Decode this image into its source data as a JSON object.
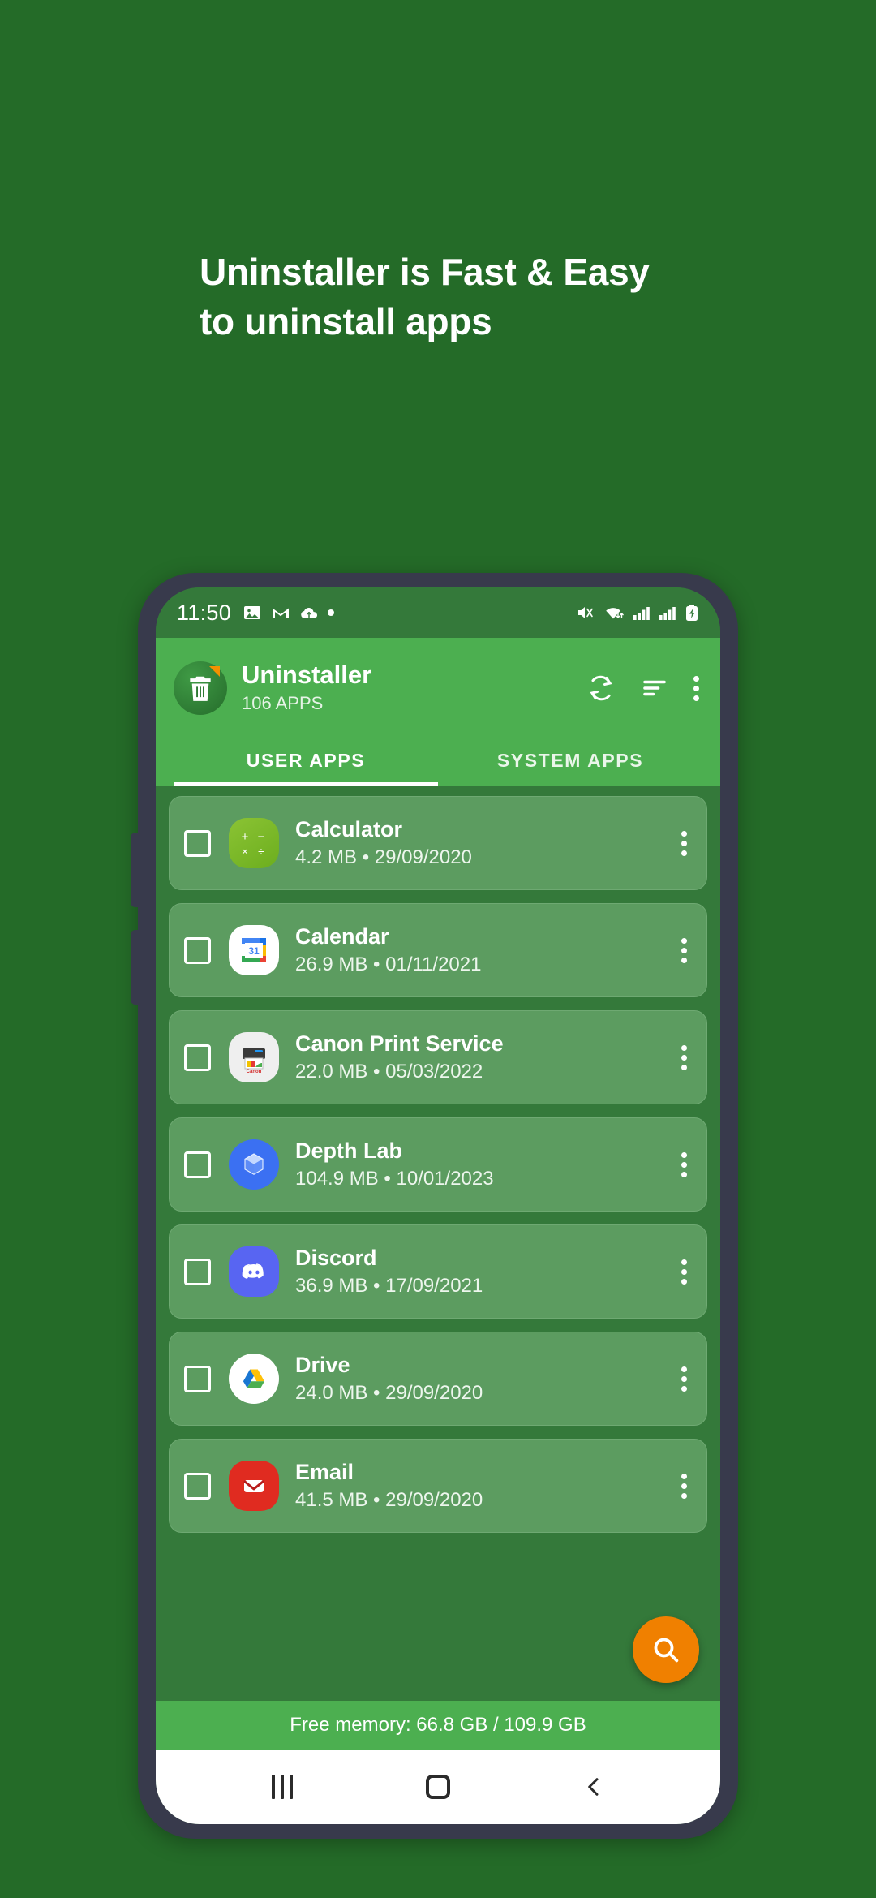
{
  "promo": {
    "headline_line1": "Uninstaller is Fast & Easy",
    "headline_line2": "to uninstall apps"
  },
  "colors": {
    "page_background": "#246B28",
    "app_bar": "#4CAF50",
    "list_background": "#34793A",
    "row_background": "#5C9C60",
    "fab": "#F08000",
    "accent_orange": "#F29100"
  },
  "status_bar": {
    "time": "11:50",
    "left_icons": [
      "photo-icon",
      "gmail-icon",
      "cloud-upload-icon",
      "dot-icon"
    ],
    "right_icons": [
      "mute-vibrate-icon",
      "wifi-icon",
      "signal-1-icon",
      "signal-2-icon",
      "battery-charging-icon"
    ]
  },
  "app_bar": {
    "logo_icon": "trash-can-icon",
    "title": "Uninstaller",
    "subtitle": "106 APPS",
    "actions": [
      {
        "name": "refresh-icon",
        "label": "Refresh"
      },
      {
        "name": "sort-icon",
        "label": "Sort"
      },
      {
        "name": "overflow-menu-icon",
        "label": "More options"
      }
    ]
  },
  "tabs": [
    {
      "label": "USER APPS",
      "active": true
    },
    {
      "label": "SYSTEM APPS",
      "active": false
    }
  ],
  "apps": [
    {
      "name": "Calculator",
      "size": "4.2 MB",
      "date": "29/09/2020",
      "detail": "4.2 MB  •  29/09/2020",
      "icon": "calculator-icon",
      "checked": false
    },
    {
      "name": "Calendar",
      "size": "26.9 MB",
      "date": "01/11/2021",
      "detail": "26.9 MB  •  01/11/2021",
      "icon": "calendar-icon",
      "checked": false
    },
    {
      "name": "Canon Print Service",
      "size": "22.0 MB",
      "date": "05/03/2022",
      "detail": "22.0 MB  •  05/03/2022",
      "icon": "canon-printer-icon",
      "checked": false
    },
    {
      "name": "Depth Lab",
      "size": "104.9 MB",
      "date": "10/01/2023",
      "detail": "104.9 MB  •  10/01/2023",
      "icon": "depth-lab-icon",
      "checked": false
    },
    {
      "name": "Discord",
      "size": "36.9 MB",
      "date": "17/09/2021",
      "detail": "36.9 MB  •  17/09/2021",
      "icon": "discord-icon",
      "checked": false
    },
    {
      "name": "Drive",
      "size": "24.0 MB",
      "date": "29/09/2020",
      "detail": "24.0 MB  •  29/09/2020",
      "icon": "google-drive-icon",
      "checked": false
    },
    {
      "name": "Email",
      "size": "41.5 MB",
      "date": "29/09/2020",
      "detail": "41.5 MB  •  29/09/2020",
      "icon": "email-icon",
      "checked": false
    }
  ],
  "fab": {
    "icon": "search-icon",
    "label": "Search"
  },
  "memory": {
    "text": "Free memory: 66.8 GB / 109.9 GB",
    "free": "66.8 GB",
    "total": "109.9 GB"
  },
  "nav_bar": {
    "recents_label": "Recents",
    "home_label": "Home",
    "back_label": "Back"
  }
}
